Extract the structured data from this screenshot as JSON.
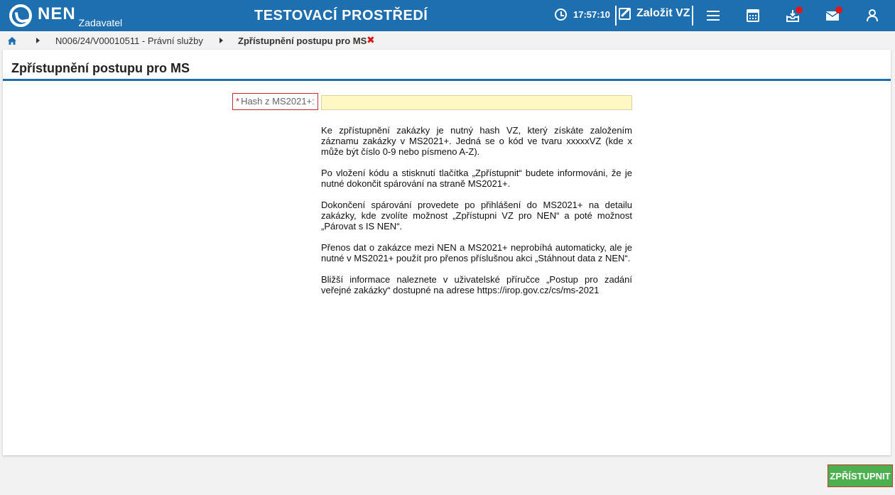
{
  "header": {
    "logo_text": "NEN",
    "logo_subtitle": "Zadavatel",
    "environment_title": "TESTOVACÍ PROSTŘEDÍ",
    "clock_time": "17:57:10",
    "create_label": "Založit VZ",
    "icons": [
      "clock-icon",
      "edit-icon",
      "menu-icon",
      "calculator-icon",
      "inbox-icon",
      "mail-icon",
      "user-icon"
    ],
    "badge_color": "#e3161b",
    "bar_color": "#1d6fb0"
  },
  "breadcrumb": {
    "items": [
      "N006/24/V00010511 - Právní služby",
      "Zpřístupnění postupu pro MS"
    ],
    "close_symbol": "✖"
  },
  "panel": {
    "title": "Zpřístupnění postupu pro MS"
  },
  "form": {
    "required_mark": "*",
    "hash_label": "Hash z MS2021+:",
    "hash_value": "",
    "hash_placeholder": ""
  },
  "help": {
    "paragraphs": [
      "Ke zpřístupnění zakázky je nutný hash VZ, který získáte založením záznamu zakázky v MS2021+. Jedná se o kód ve tvaru xxxxxVZ (kde x může být číslo 0-9 nebo písmeno A-Z).",
      "Po vložení kódu a stisknutí tlačítka „Zpřístupnit“ budete informováni, že je nutné dokončit spárování na straně MS2021+.",
      "Dokončení spárování provedete po přihlášení do MS2021+ na detailu zakázky, kde zvolíte možnost „Zpřístupni VZ pro NEN“ a poté možnost „Párovat s IS NEN“.",
      "Přenos dat o zakázce mezi NEN a MS2021+ neprobíhá automaticky, ale je nutné v MS2021+ použít pro přenos příslušnou akci „Stáhnout data z NEN“.",
      "Bližší informace naleznete v uživatelské příručce „Postup pro zadání veřejné zakázky“ dostupné na adrese https://irop.gov.cz/cs/ms-2021"
    ]
  },
  "footer": {
    "submit_label": "ZPŘÍSTUPNIT",
    "submit_color": "#4caf50"
  }
}
